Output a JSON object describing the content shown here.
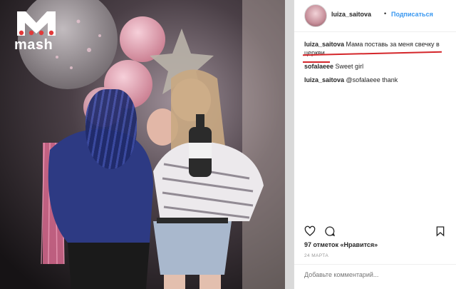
{
  "logo": {
    "brand": "mash"
  },
  "post": {
    "username": "luiza_saitova",
    "separator": "•",
    "follow_label": "Подписаться",
    "comments": [
      {
        "user": "luiza_saitova",
        "text": "Мама поставь за меня свечку в церкви"
      },
      {
        "user": "sofalaeee",
        "text": "Sweet girl"
      },
      {
        "user": "luiza_saitova",
        "text": "@sofalaeee thank"
      }
    ],
    "likes_text": "97 отметок «Нравится»",
    "date": "24 МАРТА",
    "add_comment_placeholder": "Добавьте комментарий..."
  },
  "icons": [
    "heart-icon",
    "comment-icon",
    "bookmark-icon"
  ]
}
